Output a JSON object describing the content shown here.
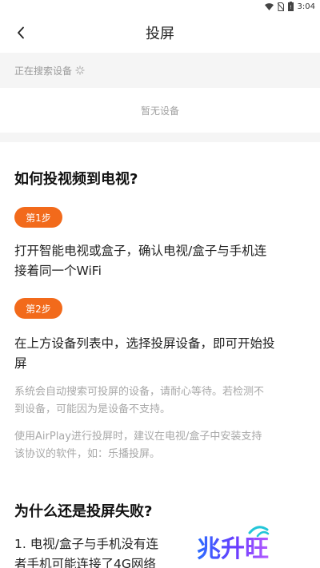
{
  "status_bar": {
    "time": "3:04",
    "icons": [
      "wifi-icon",
      "no-sim-icon",
      "battery-icon"
    ]
  },
  "header": {
    "title": "投屏",
    "back_icon": "chevron-left-icon"
  },
  "device_search": {
    "searching_text": "正在搜索设备",
    "empty_text": "暂无设备"
  },
  "help": {
    "how_title": "如何投视频到电视?",
    "step1_badge": "第1步",
    "step1_line1": "打开智能电视或盒子，确认电视/盒子与手机连",
    "step1_line2": "接着同一个WiFi",
    "step2_badge": "第2步",
    "step2_line1": "在上方设备列表中，选择投屏设备，即可开始投",
    "step2_line2": "屏",
    "note1_line1": "系统会自动搜索可投屏的设备，请耐心等待。若检测不",
    "note1_line2": "到设备，可能因为是设备不支持。",
    "note2_line1": "使用AirPlay进行投屏时，建议在电视/盒子中安装支持",
    "note2_line2": "该协议的软件，如：乐播投屏。",
    "why_title": "为什么还是投屏失败?",
    "reason1_line1": "1. 电视/盒子与手机没有连",
    "reason1_line2": "者手机可能连接了4G网络"
  },
  "watermark": {
    "text": "兆升旺"
  }
}
